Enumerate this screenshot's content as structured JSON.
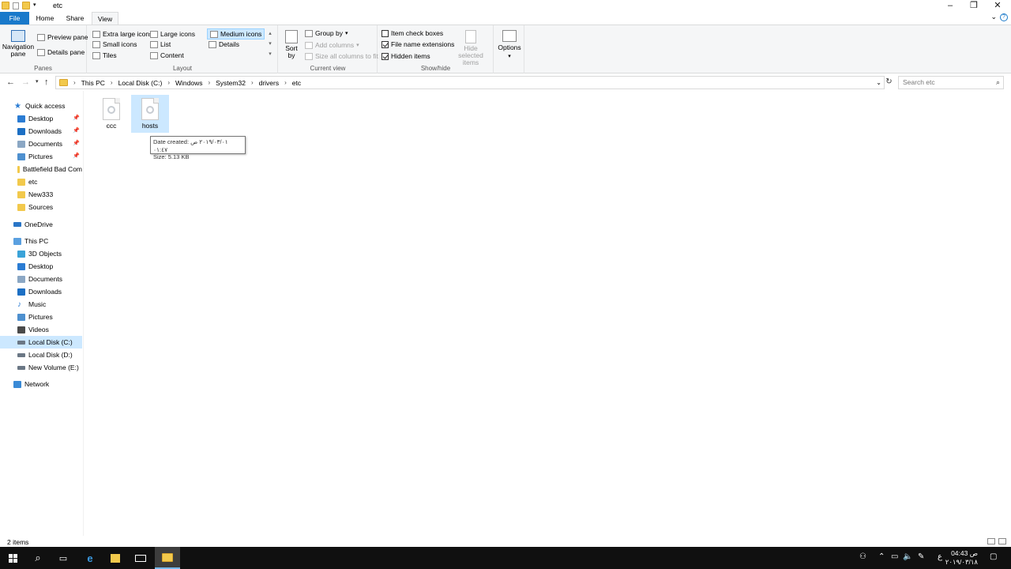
{
  "window": {
    "title": "etc",
    "controls": [
      "minimize",
      "maximize",
      "close"
    ]
  },
  "ribbon_tabs": [
    "File",
    "Home",
    "Share",
    "View"
  ],
  "ribbon": {
    "panes": {
      "label": "Panes",
      "navigation_pane": "Navigation pane",
      "preview_pane": "Preview pane",
      "details_pane": "Details pane"
    },
    "layout": {
      "label": "Layout",
      "options": [
        "Extra large icons",
        "Large icons",
        "Medium icons",
        "Small icons",
        "List",
        "Details",
        "Tiles",
        "Content"
      ],
      "selected": "Medium icons"
    },
    "current_view": {
      "label": "Current view",
      "sort_by": "Sort by",
      "group_by": "Group by",
      "add_columns": "Add columns",
      "size_all_columns": "Size all columns to fit"
    },
    "show_hide": {
      "label": "Show/hide",
      "item_check_boxes": {
        "label": "Item check boxes",
        "checked": false
      },
      "file_name_extensions": {
        "label": "File name extensions",
        "checked": true
      },
      "hidden_items": {
        "label": "Hidden items",
        "checked": true
      },
      "hide_selected_items": "Hide selected items"
    },
    "options": "Options"
  },
  "address": {
    "path": [
      "This PC",
      "Local Disk (C:)",
      "Windows",
      "System32",
      "drivers",
      "etc"
    ],
    "search_placeholder": "Search etc"
  },
  "nav_pane": {
    "quick_access": "Quick access",
    "quick_items": [
      {
        "label": "Desktop",
        "pinned": true
      },
      {
        "label": "Downloads",
        "pinned": true
      },
      {
        "label": "Documents",
        "pinned": true
      },
      {
        "label": "Pictures",
        "pinned": true
      },
      {
        "label": "Battlefield Bad Com",
        "pinned": false
      },
      {
        "label": "etc",
        "pinned": false
      },
      {
        "label": "New333",
        "pinned": false
      },
      {
        "label": "Sources",
        "pinned": false
      }
    ],
    "onedrive": "OneDrive",
    "this_pc": "This PC",
    "pc_items": [
      "3D Objects",
      "Desktop",
      "Documents",
      "Downloads",
      "Music",
      "Pictures",
      "Videos",
      "Local Disk (C:)",
      "Local Disk (D:)",
      "New Volume (E:)"
    ],
    "selected": "Local Disk (C:)",
    "network": "Network"
  },
  "files": [
    {
      "name": "ccc",
      "selected": false
    },
    {
      "name": "hosts",
      "selected": true
    }
  ],
  "tooltip": {
    "line1": "Date created: ٢٠١٩/٠٣/٠١ ص ٠١:٤٧",
    "line2": "Size: 5.13 KB"
  },
  "status": {
    "item_count": "2 items"
  },
  "taskbar": {
    "tray_lang": "ع",
    "time": "04:43 ص",
    "date": "٢٠١٩/٠٣/١٨"
  }
}
